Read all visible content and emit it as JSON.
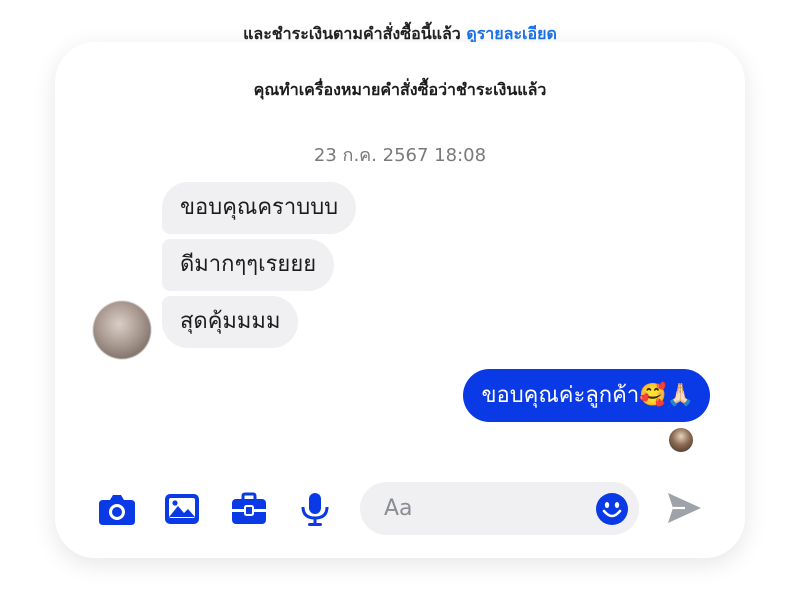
{
  "header": {
    "cut_text": "และชำระเงินตามคำสั่งซื้อนี้แล้ว",
    "cut_link": "ดูรายละเอียด",
    "notice": "คุณทำเครื่องหมายคำสั่งซื้อว่าชำระเงินแล้ว"
  },
  "conversation": {
    "timestamp": "23 ก.ค. 2567 18:08",
    "incoming": [
      {
        "text": "ขอบคุณคราบบบ"
      },
      {
        "text": "ดีมากๆๆเรยยย"
      },
      {
        "text": "สุดคุ้มมมม"
      }
    ],
    "outgoing": [
      {
        "text": "ขอบคุณค่ะลูกค้า🥰🙏🏻"
      }
    ]
  },
  "composer": {
    "placeholder": "Aa",
    "icons": {
      "camera": "camera-icon",
      "gallery": "image-icon",
      "briefcase": "briefcase-icon",
      "mic": "microphone-icon",
      "emoji": "smiley-icon",
      "send": "send-icon"
    },
    "accent_color": "#0a3ae6",
    "send_color": "#9ea2a9"
  }
}
